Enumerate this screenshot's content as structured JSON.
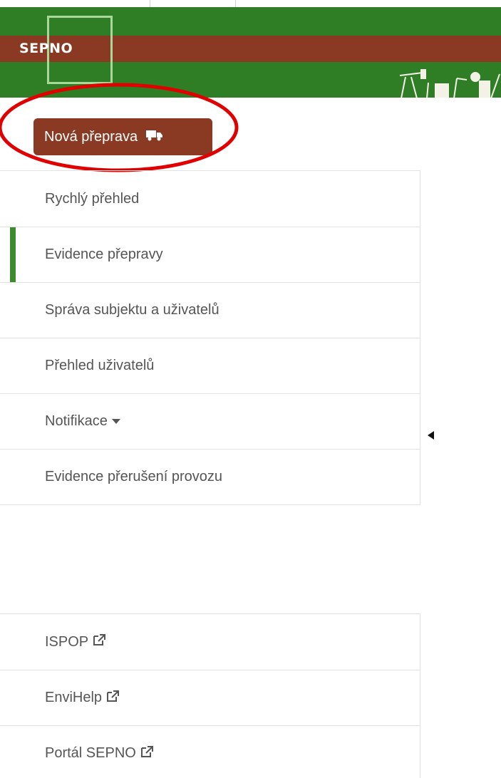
{
  "banner": {
    "logo_text": "SEPNO"
  },
  "new_transport_button": {
    "label": "Nová přeprava"
  },
  "nav": {
    "items": [
      {
        "label": "Rychlý přehled"
      },
      {
        "label": "Evidence přepravy"
      },
      {
        "label": "Správa subjektu a uživatelů"
      },
      {
        "label": "Přehled uživatelů"
      },
      {
        "label": "Notifikace"
      },
      {
        "label": "Evidence přerušení provozu"
      }
    ],
    "active_item": "Evidence přepravy"
  },
  "external_links": [
    {
      "label": "ISPOP"
    },
    {
      "label": "EnviHelp"
    },
    {
      "label": "Portál SEPNO"
    }
  ],
  "colors": {
    "banner_green": "#2f7d24",
    "banner_brown": "#8a3a22",
    "button_brown": "#8a3a22",
    "active_indicator": "#3c8c2f",
    "annotation_red": "#e00000"
  },
  "icons": [
    "truck-icon",
    "caret-down-icon",
    "collapse-left-icon",
    "external-link-icon"
  ]
}
